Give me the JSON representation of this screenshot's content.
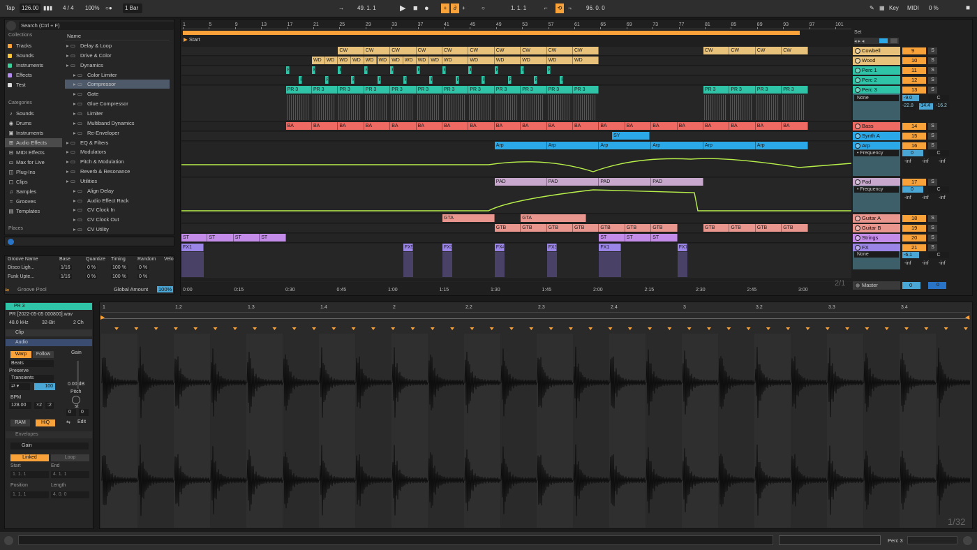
{
  "transport": {
    "tap": "Tap",
    "tempo": "126.00",
    "sig": "4 / 4",
    "zoom": "100%",
    "quant": "1 Bar",
    "pos": "49. 1. 1",
    "loop_start": "1. 1. 1",
    "loop_len": "96. 0. 0",
    "key": "Key",
    "midi": "MIDI",
    "cpu": "0 %"
  },
  "browser": {
    "search": "Search (Ctrl + F)",
    "collections_title": "Collections",
    "collections": [
      {
        "label": "Tracks",
        "color": "#f9a23a"
      },
      {
        "label": "Sounds",
        "color": "#f9c63a"
      },
      {
        "label": "Instruments",
        "color": "#3ad29a"
      },
      {
        "label": "Effects",
        "color": "#b58cf0"
      },
      {
        "label": "Test",
        "color": "#dddddd"
      }
    ],
    "categories_title": "Categories",
    "categories": [
      "Sounds",
      "Drums",
      "Instruments",
      "Audio Effects",
      "MIDI Effects",
      "Max for Live",
      "Plug-Ins",
      "Clips",
      "Samples",
      "Grooves",
      "Templates"
    ],
    "places": "Places",
    "name_header": "Name",
    "files": [
      "Delay & Loop",
      "Drive & Color",
      "Dynamics",
      "Color Limiter",
      "Compressor",
      "Gate",
      "Glue Compressor",
      "Limiter",
      "Multiband Dynamics",
      "Re-Enveloper",
      "EQ & Filters",
      "Modulators",
      "Pitch & Modulation",
      "Reverb & Resonance",
      "Utilities",
      "Align Delay",
      "Audio Effect Rack",
      "CV Clock In",
      "CV Clock Out",
      "CV Utility"
    ]
  },
  "groove": {
    "headers": [
      "Groove Name",
      "Base",
      "Quantize",
      "Timing",
      "Random",
      "Velo"
    ],
    "rows": [
      [
        "Disco Ligh...",
        "1/16",
        "0 %",
        "100 %",
        "0 %"
      ],
      [
        "Funk Upte...",
        "1/16",
        "0 %",
        "100 %",
        "0 %"
      ]
    ],
    "pool": "Groove Pool",
    "amount_label": "Global Amount",
    "amount": "100%"
  },
  "arrangement": {
    "bars": [
      "1",
      "5",
      "9",
      "13",
      "17",
      "21",
      "25",
      "29",
      "33",
      "37",
      "41",
      "45",
      "49",
      "53",
      "57",
      "61",
      "65",
      "69",
      "73",
      "77",
      "81",
      "85",
      "89",
      "93",
      "97",
      "101"
    ],
    "times": [
      "0:00",
      "0:15",
      "0:30",
      "0:45",
      "1:00",
      "1:15",
      "1:30",
      "1:45",
      "2:00",
      "2:15",
      "2:30",
      "2:45",
      "3:00"
    ],
    "start_marker": "Start",
    "set": "Set",
    "page": "2/1"
  },
  "tracks": [
    {
      "name": "Cowbell",
      "num": "9",
      "color": "#e8c27a"
    },
    {
      "name": "Wood",
      "num": "10",
      "color": "#e8c27a"
    },
    {
      "name": "Perc 1",
      "num": "11",
      "color": "#2fc4a8"
    },
    {
      "name": "Perc 2",
      "num": "12",
      "color": "#2fc4a8"
    },
    {
      "name": "Perc 3",
      "num": "13",
      "color": "#2fc4a8"
    },
    {
      "name": "Bass",
      "num": "14",
      "color": "#f06a64"
    },
    {
      "name": "Synth A",
      "num": "15",
      "color": "#2aa8e8"
    },
    {
      "name": "Arp",
      "num": "16",
      "color": "#2aa8e8"
    },
    {
      "name": "Pad",
      "num": "17",
      "color": "#c8a8cc"
    },
    {
      "name": "Guitar A",
      "num": "18",
      "color": "#e8968e"
    },
    {
      "name": "Guitar B",
      "num": "19",
      "color": "#e8968e"
    },
    {
      "name": "Strings",
      "num": "20",
      "color": "#c28ce8"
    },
    {
      "name": "FX",
      "num": "21",
      "color": "#9b86e8"
    },
    {
      "name": "Master",
      "num": "0",
      "color": "#3a3a3a"
    }
  ],
  "mixer": {
    "perc3_vol": "-9.0",
    "perc3_pan": "C",
    "route": "None",
    "perc3_meters": [
      "-22.8",
      "-14.4",
      "-16.2"
    ],
    "device_param": "Frequency",
    "zero": "0",
    "inf": "-inf",
    "fx_vol": "-6.1",
    "master_vol": "0",
    "master_s": "0"
  },
  "clips": {
    "cowbell": "CW",
    "wood": "WD",
    "perc3": "PR 3",
    "bass": "BA",
    "synth": "SY",
    "arp": "Arp",
    "pad": "PAD",
    "guitarA": "GTA",
    "guitarB": "GTB",
    "strings": "ST",
    "fx": [
      "FX1",
      "FX5",
      "FX3",
      "FX4",
      "FX3",
      "FX1",
      "FX7"
    ]
  },
  "clip_view": {
    "title": "PR 3",
    "file": "PR [2022-05-05 000800].wav",
    "rate": "48.0 kHz",
    "bits": "32-Bit",
    "ch": "2 Ch",
    "clip": "Clip",
    "audio": "Audio",
    "warp": "Warp",
    "follow": "Follow",
    "mode": "Beats",
    "preserve": "Preserve",
    "transients": "Transients",
    "gain_label": "Gain",
    "gain": "0.00 dB",
    "pitch_label": "Pitch",
    "st": "st",
    "pitch_val": [
      "0",
      "0"
    ],
    "bpm_label": "BPM",
    "bpm": "128.00",
    "x2": "×2",
    "half": ":2",
    "percent": "100",
    "ram": "RAM",
    "hiq": "HiQ",
    "edit": "Edit",
    "envelopes": "Envelopes",
    "env_param": "Gain",
    "linked": "Linked",
    "loop": "Loop",
    "start": "Start",
    "end": "End",
    "position": "Position",
    "length": "Length",
    "start_val": "1. 1. 1",
    "end_val": "4. 1. 1",
    "pos_val": "1. 1. 1",
    "len_val": "4. 0. 0",
    "ruler": [
      "1",
      "1.2",
      "1.3",
      "1.4",
      "2",
      "2.2",
      "2.3",
      "2.4",
      "3",
      "3.2",
      "3.3",
      "3.4"
    ],
    "page": "1/32"
  },
  "status": {
    "track": "Perc 3"
  }
}
